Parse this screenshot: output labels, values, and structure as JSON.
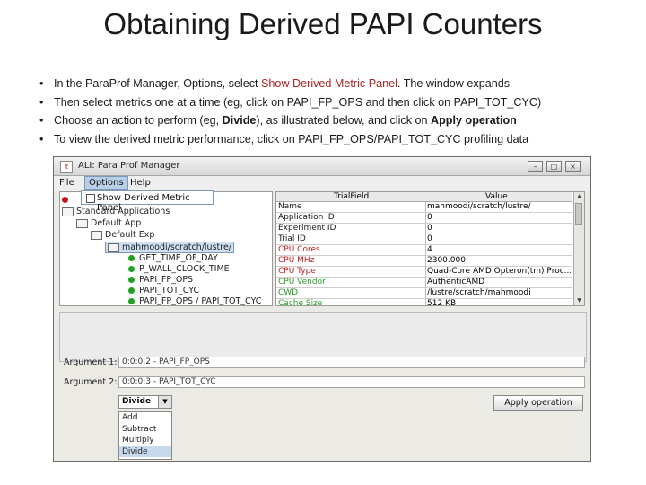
{
  "slide": {
    "title": "Obtaining Derived PAPI Counters",
    "bullets": [
      {
        "a": "In the Para",
        "b": "Prof Manager, Options, select ",
        "hl": "Show Derived Metric Panel",
        "c": ".  The window expands"
      },
      {
        "text": "Then select metrics one at a time (eg, click on PAPI_FP_OPS and then click on PAPI_TOT_CYC)"
      },
      {
        "pre": "Choose an action to perform (eg, ",
        "bold": "Divide",
        "mid": "), as illustrated below, and click on ",
        "bold2": "Apply operation"
      },
      {
        "text": "To view the derived metric performance, click on PAPI_FP_OPS/PAPI_TOT_CYC profiling data"
      }
    ]
  },
  "window": {
    "icon": "paraprof-icon",
    "title": "ALI: Para Prof Manager",
    "menu": [
      "File",
      "Options",
      "Help"
    ],
    "dropdown_item": "Show Derived Metric Panel",
    "tree": {
      "root": "Standard Applications",
      "app": "Default App",
      "exp": "Default Exp",
      "trial": "mahmoodi/scratch/lustre/",
      "metrics": [
        "GET_TIME_OF_DAY",
        "P_WALL_CLOCK_TIME",
        "PAPI_FP_OPS",
        "PAPI_TOT_CYC",
        "PAPI_FP_OPS / PAPI_TOT_CYC"
      ]
    },
    "table": {
      "headers": [
        "TrialField",
        "Value"
      ],
      "rows": [
        {
          "field": "Name",
          "value": "mahmoodi/scratch/lustre/",
          "color": "#1a1a1a"
        },
        {
          "field": "Application ID",
          "value": "0",
          "color": "#1a1a1a"
        },
        {
          "field": "Experiment ID",
          "value": "0",
          "color": "#1a1a1a"
        },
        {
          "field": "Trial ID",
          "value": "0",
          "color": "#1a1a1a"
        },
        {
          "field": "CPU Cores",
          "value": "4",
          "color": "#c02020"
        },
        {
          "field": "CPU MHz",
          "value": "2300.000",
          "color": "#c02020"
        },
        {
          "field": "CPU Type",
          "value": "Quad-Core AMD Opteron(tm) Proc...",
          "color": "#c02020"
        },
        {
          "field": "CPU Vendor",
          "value": "AuthenticAMD",
          "color": "#2a9a2a"
        },
        {
          "field": "CWD",
          "value": "/lustre/scratch/mahmoodi",
          "color": "#2a9a2a"
        },
        {
          "field": "Cache Size",
          "value": "512 KB",
          "color": "#2a9a2a"
        }
      ]
    },
    "argument1_label": "Argument 1:",
    "argument1_value": "0:0:0:2 - PAPI_FP_OPS",
    "argument2_label": "Argument 2:",
    "argument2_value": "0:0:0:3 - PAPI_TOT_CYC",
    "operation_selected": "Divide",
    "operations": [
      "Add",
      "Subtract",
      "Multiply",
      "Divide"
    ],
    "apply_label": "Apply operation"
  }
}
